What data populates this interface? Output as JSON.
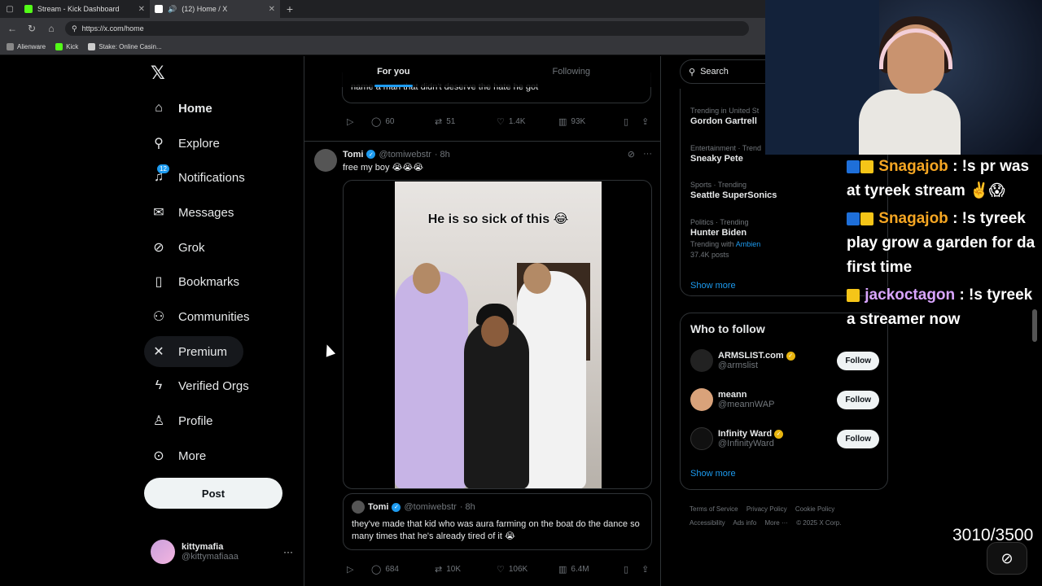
{
  "browser": {
    "tabs": [
      {
        "title": "Stream - Kick Dashboard",
        "favicon_color": "#53fc18",
        "active": false
      },
      {
        "title": "(12) Home / X",
        "favicon_color": "#ffffff",
        "active": true
      }
    ],
    "url": "https://x.com/home",
    "bookmarks": [
      {
        "label": "Alienware",
        "color": "#888888"
      },
      {
        "label": "Kick",
        "color": "#53fc18"
      },
      {
        "label": "Stake: Online Casin...",
        "color": "#cccccc"
      }
    ]
  },
  "nav": {
    "items": [
      {
        "label": "Home",
        "icon": "home-icon",
        "glyph": "⌂"
      },
      {
        "label": "Explore",
        "icon": "search-icon",
        "glyph": "⌕"
      },
      {
        "label": "Notifications",
        "icon": "bell-icon",
        "glyph": "🔔",
        "badge": "12"
      },
      {
        "label": "Messages",
        "icon": "mail-icon",
        "glyph": "✉"
      },
      {
        "label": "Grok",
        "icon": "grok-icon",
        "glyph": "⊘"
      },
      {
        "label": "Bookmarks",
        "icon": "bookmark-icon",
        "glyph": "⎘"
      },
      {
        "label": "Communities",
        "icon": "people-icon",
        "glyph": "⚇"
      },
      {
        "label": "Premium",
        "icon": "x-premium-icon",
        "glyph": "𝕏"
      },
      {
        "label": "Verified Orgs",
        "icon": "lightning-icon",
        "glyph": "ϟ"
      },
      {
        "label": "Profile",
        "icon": "person-icon",
        "glyph": "♙"
      },
      {
        "label": "More",
        "icon": "more-circle-icon",
        "glyph": "⊙"
      }
    ],
    "post_label": "Post",
    "user": {
      "name": "kittymafia",
      "handle": "@kittymafiaaa"
    }
  },
  "feed": {
    "tabs": [
      "For you",
      "Following"
    ],
    "prev_quote_text": "name a man that didn't deserve the hate he got",
    "prev_actions": {
      "replies": "60",
      "reposts": "51",
      "likes": "1.4K",
      "views": "93K"
    },
    "tweet": {
      "name": "Tomi",
      "handle": "@tomiwebstr",
      "time": "· 8h",
      "text": "free my boy 😭😭😭",
      "video_caption": "He is so sick of this 😂",
      "quote": {
        "name": "Tomi",
        "handle": "@tomiwebstr",
        "time": "· 8h",
        "text": "they've made that kid who was aura farming on the boat do the dance so many times that he's already tired of it 😭"
      },
      "actions": {
        "replies": "684",
        "reposts": "10K",
        "likes": "106K",
        "views": "6.4M"
      }
    }
  },
  "sidebar": {
    "search_placeholder": "Search",
    "trends": [
      {
        "category": "Trending in United St",
        "name": "Gordon Gartrell"
      },
      {
        "category": "Entertainment · Trend",
        "name": "Sneaky Pete"
      },
      {
        "category": "Sports · Trending",
        "name": "Seattle SuperSonics"
      },
      {
        "category": "Politics · Trending",
        "name": "Hunter Biden",
        "with_prefix": "Trending with",
        "with_link": "Ambien",
        "posts": "37.4K posts"
      }
    ],
    "show_more": "Show more",
    "who_to_follow_title": "Who to follow",
    "who_to_follow": [
      {
        "name": "ARMSLIST.com",
        "handle": "@armslist",
        "verified": true,
        "avatar_color": "#222222"
      },
      {
        "name": "meann",
        "handle": "@meannWAP",
        "verified": false,
        "avatar_color": "#d9a27a"
      },
      {
        "name": "Infinity Ward",
        "handle": "@InfinityWard",
        "verified": true,
        "avatar_color": "#111111"
      }
    ],
    "follow_label": "Follow",
    "footer": [
      "Terms of Service",
      "Privacy Policy",
      "Cookie Policy",
      "Accessibility",
      "Ads info",
      "More ···",
      "© 2025 X Corp."
    ]
  },
  "stream": {
    "chat": [
      {
        "user": "Snagajob",
        "text": ": !s pr was at tyreek stream ✌️😱",
        "badges": 2
      },
      {
        "user": "Snagajob",
        "text": ": !s tyreek play grow a garden for da first time",
        "badges": 2
      },
      {
        "user": "jackoctagon",
        "text": ": !s tyreek a streamer now",
        "badges": 1
      }
    ],
    "counter": "3010/3500"
  }
}
